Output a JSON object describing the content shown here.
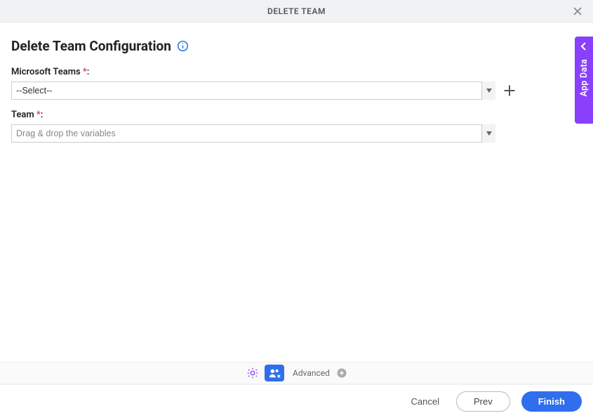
{
  "header": {
    "title": "DELETE TEAM"
  },
  "page": {
    "title": "Delete Team Configuration"
  },
  "form": {
    "teams_label": "Microsoft Teams ",
    "teams_value": "--Select--",
    "team_label": "Team ",
    "team_placeholder": "Drag & drop the variables",
    "required_marker": "*"
  },
  "side_tab": {
    "label": "App Data"
  },
  "footer": {
    "advanced_label": "Advanced"
  },
  "actions": {
    "cancel": "Cancel",
    "prev": "Prev",
    "finish": "Finish"
  }
}
